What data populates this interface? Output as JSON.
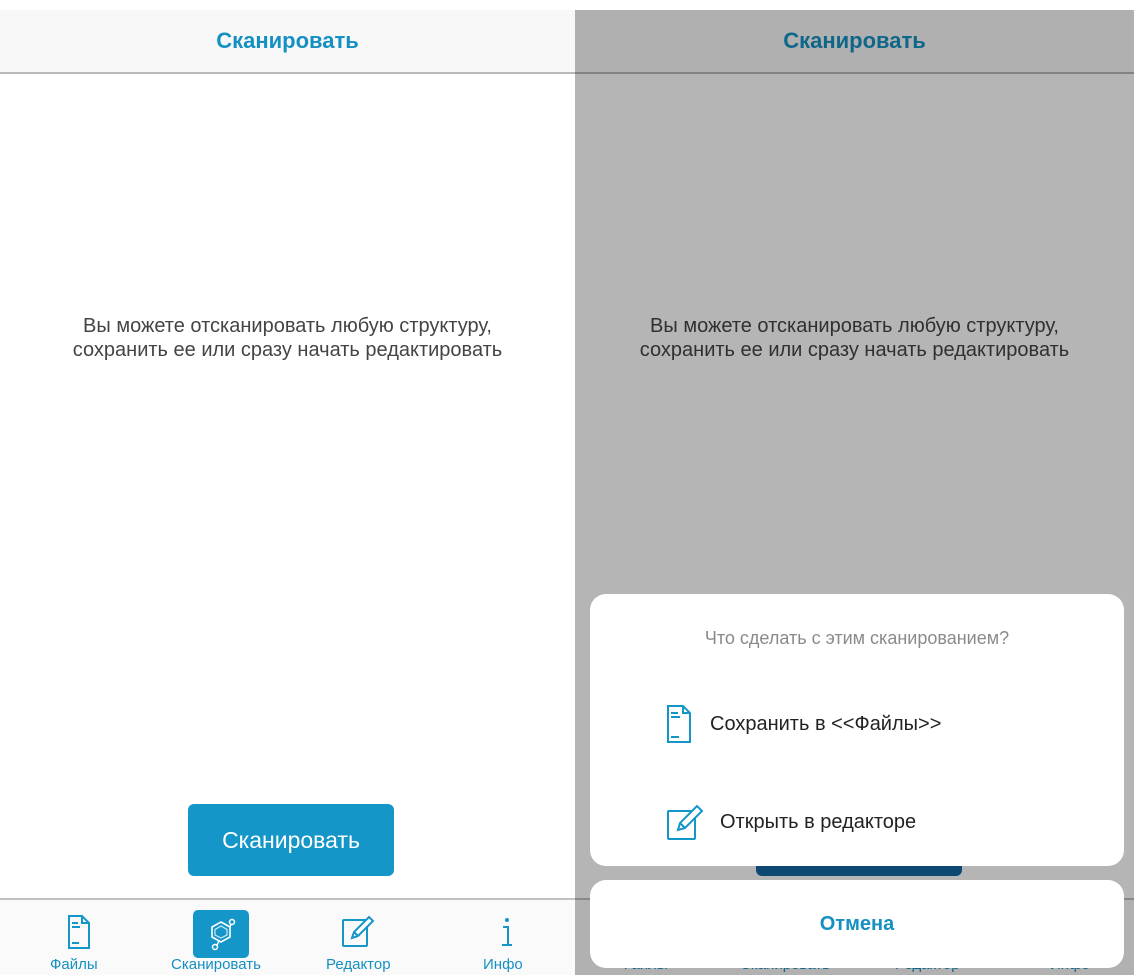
{
  "left": {
    "header": {
      "title": "Сканировать"
    },
    "description": {
      "line1": "Вы можете отсканировать любую структуру,",
      "line2": "сохранить ее или сразу начать редактировать"
    },
    "scan_button_label": "Сканировать",
    "tabs": [
      {
        "label": "Файлы",
        "icon": "file-icon"
      },
      {
        "label": "Сканировать",
        "icon": "molecule-icon",
        "active": true
      },
      {
        "label": "Редактор",
        "icon": "edit-icon"
      },
      {
        "label": "Инфо",
        "icon": "info-icon"
      }
    ]
  },
  "right": {
    "header": {
      "title": "Сканировать"
    },
    "description": {
      "line1": "Вы можете отсканировать любую структуру,",
      "line2": "сохранить ее или сразу начать редактировать"
    },
    "tabs": [
      {
        "label": "Файлы"
      },
      {
        "label": "Сканировать"
      },
      {
        "label": "Редактор"
      },
      {
        "label": "Инфо"
      }
    ],
    "sheet": {
      "question": "Что сделать с этим сканированием?",
      "options": [
        {
          "label": "Сохранить в <<Файлы>>",
          "icon": "file-icon"
        },
        {
          "label": "Открыть в редакторе",
          "icon": "edit-icon"
        }
      ],
      "cancel_label": "Отмена"
    }
  },
  "colors": {
    "accent": "#1596c8",
    "title_text": "#1590c2",
    "body_text": "#444444",
    "overlay": "rgba(0,0,0,0.29)"
  }
}
